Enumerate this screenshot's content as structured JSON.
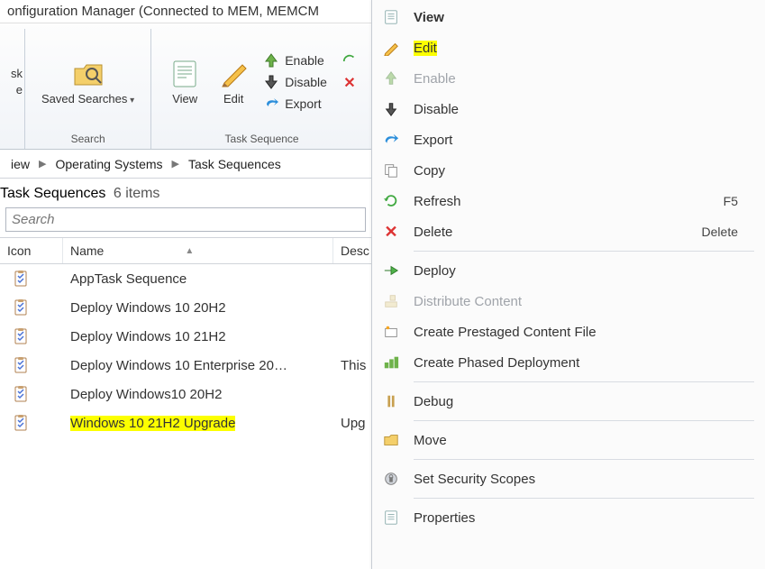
{
  "window": {
    "title": "onfiguration Manager (Connected to MEM, MEMCM"
  },
  "ribbon": {
    "group_left": {
      "truncated_top": "sk",
      "truncated_bottom": "e"
    },
    "search_group": {
      "saved_searches": "Saved\nSearches",
      "label": "Search"
    },
    "ts_group": {
      "view": "View",
      "edit": "Edit",
      "enable": "Enable",
      "disable": "Disable",
      "export": "Export",
      "label": "Task Sequence"
    }
  },
  "breadcrumb": {
    "items": [
      "iew",
      "Operating Systems",
      "Task Sequences"
    ]
  },
  "list": {
    "heading": "Task Sequences",
    "count_text": "6 items",
    "search_placeholder": "Search",
    "columns": {
      "icon": "Icon",
      "name": "Name",
      "desc": "Desc"
    },
    "rows": [
      {
        "name": "AppTask Sequence",
        "desc": ""
      },
      {
        "name": "Deploy Windows 10 20H2",
        "desc": ""
      },
      {
        "name": "Deploy Windows 10 21H2",
        "desc": ""
      },
      {
        "name": "Deploy Windows 10 Enterprise 20…",
        "desc": "This"
      },
      {
        "name": "Deploy Windows10 20H2",
        "desc": ""
      },
      {
        "name": "Windows 10 21H2 Upgrade",
        "desc": "Upg",
        "highlighted": true
      }
    ]
  },
  "context_menu": {
    "items": [
      {
        "kind": "item",
        "label": "View",
        "icon": "properties",
        "bold": true
      },
      {
        "kind": "item",
        "label": "Edit",
        "icon": "pencil",
        "highlighted": true
      },
      {
        "kind": "item",
        "label": "Enable",
        "icon": "arrow-up-green",
        "disabled": true
      },
      {
        "kind": "item",
        "label": "Disable",
        "icon": "arrow-down-dark"
      },
      {
        "kind": "item",
        "label": "Export",
        "icon": "arrow-curve-blue"
      },
      {
        "kind": "item",
        "label": "Copy",
        "icon": "copy"
      },
      {
        "kind": "item",
        "label": "Refresh",
        "icon": "refresh",
        "shortcut": "F5"
      },
      {
        "kind": "item",
        "label": "Delete",
        "icon": "delete-x",
        "shortcut": "Delete"
      },
      {
        "kind": "sep"
      },
      {
        "kind": "item",
        "label": "Deploy",
        "icon": "arrow-right-green"
      },
      {
        "kind": "item",
        "label": "Distribute Content",
        "icon": "distribute",
        "disabled": true
      },
      {
        "kind": "item",
        "label": "Create Prestaged Content File",
        "icon": "prestage"
      },
      {
        "kind": "item",
        "label": "Create Phased Deployment",
        "icon": "phased"
      },
      {
        "kind": "sep"
      },
      {
        "kind": "item",
        "label": "Debug",
        "icon": "debug"
      },
      {
        "kind": "sep"
      },
      {
        "kind": "item",
        "label": "Move",
        "icon": "folder"
      },
      {
        "kind": "sep"
      },
      {
        "kind": "item",
        "label": "Set Security Scopes",
        "icon": "security"
      },
      {
        "kind": "sep"
      },
      {
        "kind": "item",
        "label": "Properties",
        "icon": "properties"
      }
    ]
  }
}
